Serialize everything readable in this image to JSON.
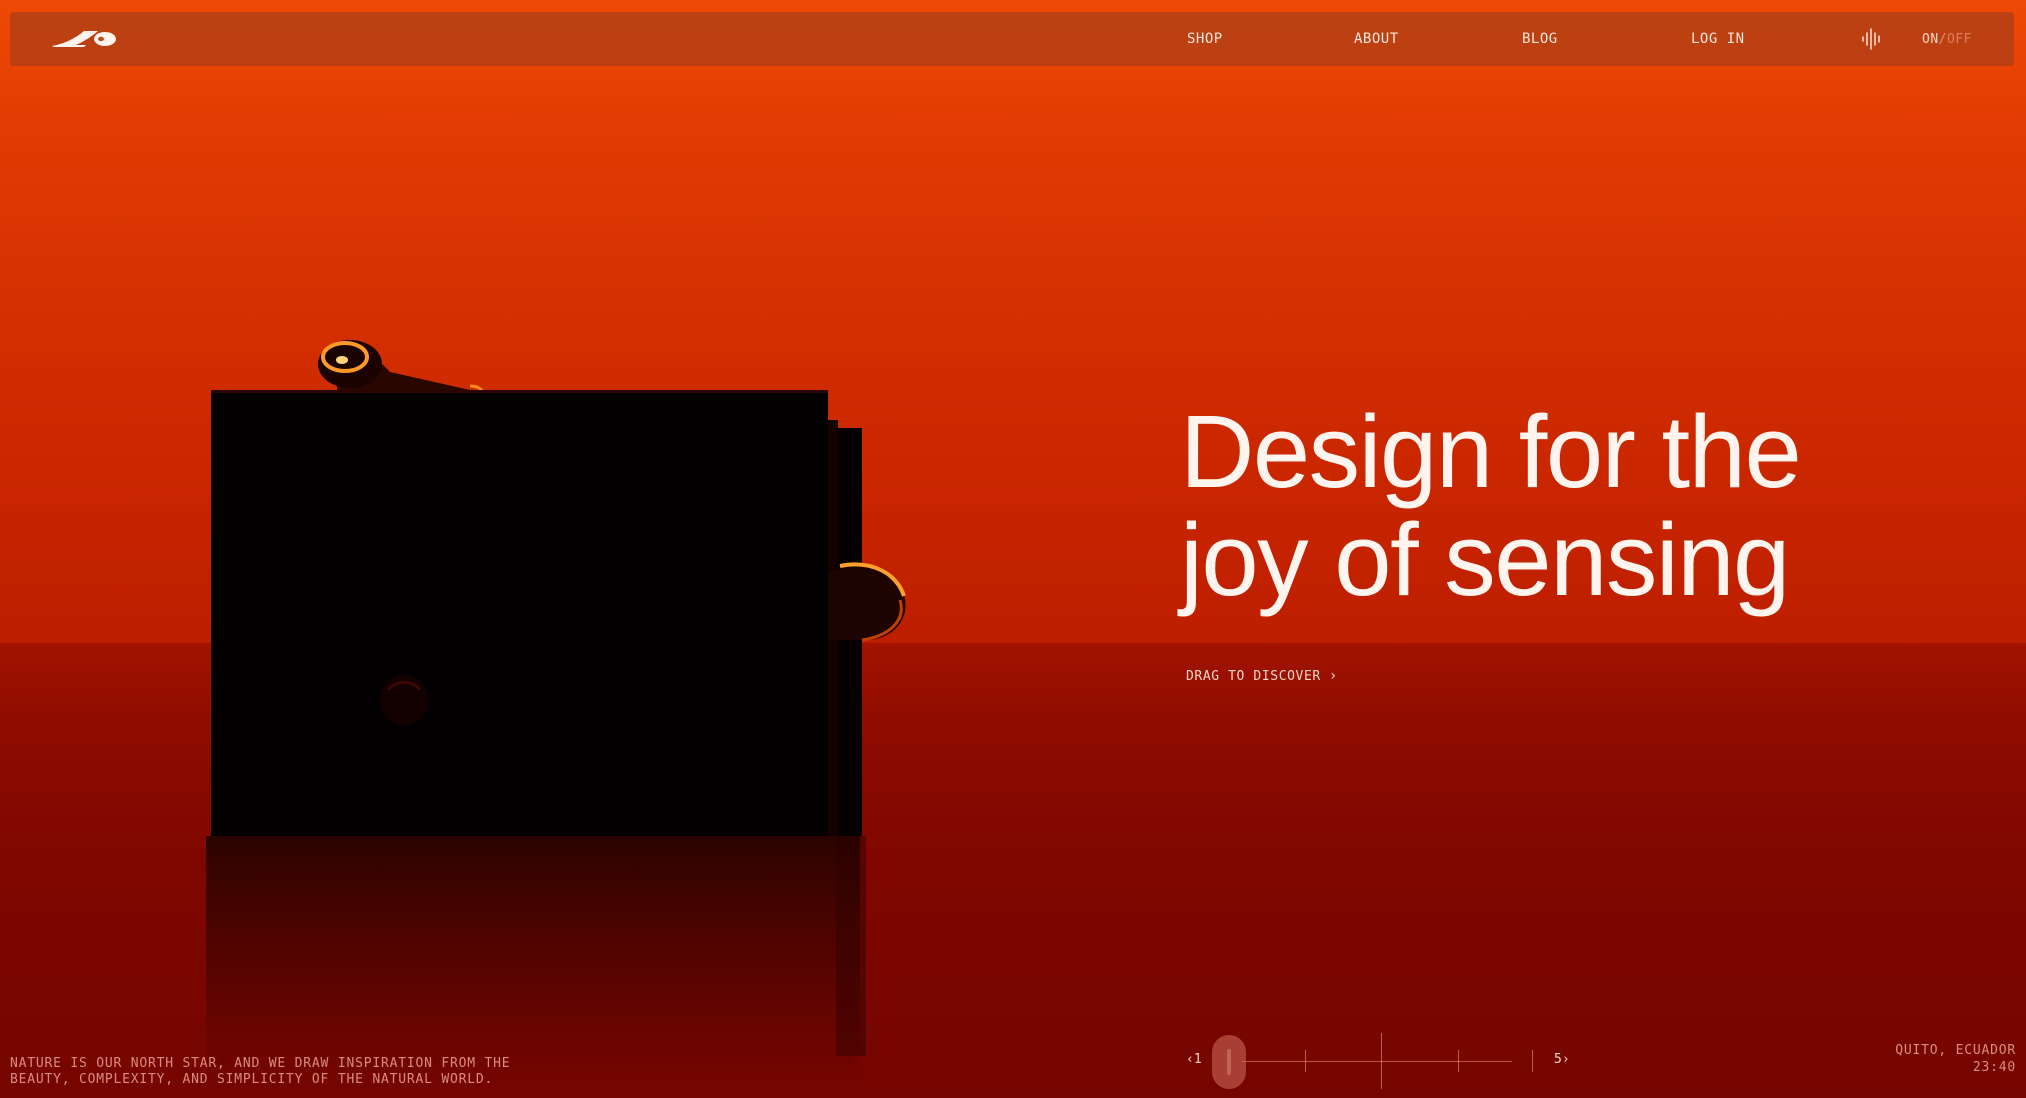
{
  "nav": {
    "logo": "brand-logo",
    "links": {
      "shop": "SHOP",
      "about": "ABOUT",
      "blog": "BLOG",
      "login": "LOG IN"
    },
    "sound_icon": "sound-wave-icon",
    "toggle": {
      "on": "ON",
      "separator": "/",
      "off": "OFF"
    }
  },
  "hero": {
    "headline_line1": "Design for the",
    "headline_line2": "joy of sensing",
    "cta_label": "DRAG TO DISCOVER",
    "cta_icon": "chevron-right-icon"
  },
  "footer": {
    "tagline_line1": "NATURE IS OUR NORTH STAR, AND WE DRAW INSPIRATION FROM THE",
    "tagline_line2": "BEAUTY, COMPLEXITY, AND SIMPLICITY OF THE NATURAL WORLD.",
    "location_city": "QUITO, ECUADOR",
    "location_time": "23:40"
  },
  "slider": {
    "prev_label": "‹1",
    "next_label": "5›",
    "current": 1,
    "total": 5
  },
  "colors": {
    "sky_top": "#ee4a05",
    "floor": "#800700",
    "text": "#fff4ee",
    "muted_text": "#f0aa96"
  }
}
